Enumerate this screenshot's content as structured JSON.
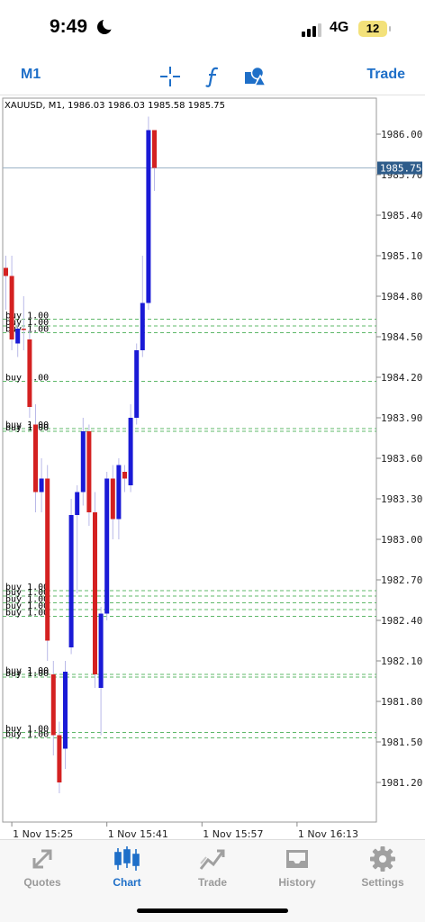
{
  "status": {
    "time": "9:49",
    "network": "4G",
    "battery": "12"
  },
  "toolbar": {
    "period": "M1",
    "icons": [
      "crosshair-icon",
      "function-icon",
      "objects-icon"
    ],
    "trade_label": "Trade",
    "accent": "#1e6fc8"
  },
  "chart_data": {
    "type": "candlestick",
    "title": "XAUUSD, M1, 1986.03 1986.03 1985.58 1985.75",
    "symbol": "XAUUSD",
    "timeframe": "M1",
    "ohlc_header": {
      "open": 1986.03,
      "high": 1986.03,
      "low": 1985.58,
      "close": 1985.75
    },
    "current_price": 1985.75,
    "current_price_label": "1985.75",
    "ylim": [
      1981.05,
      1986.15
    ],
    "y_ticks": [
      {
        "v": 1986.0,
        "label": "1986.00"
      },
      {
        "v": 1985.7,
        "label": "1985.70"
      },
      {
        "v": 1985.4,
        "label": "1985.40"
      },
      {
        "v": 1985.1,
        "label": "1985.10"
      },
      {
        "v": 1984.8,
        "label": "1984.80"
      },
      {
        "v": 1984.5,
        "label": "1984.50"
      },
      {
        "v": 1984.2,
        "label": "1984.20"
      },
      {
        "v": 1983.9,
        "label": "1983.90"
      },
      {
        "v": 1983.6,
        "label": "1983.60"
      },
      {
        "v": 1983.3,
        "label": "1983.30"
      },
      {
        "v": 1983.0,
        "label": "1983.00"
      },
      {
        "v": 1982.7,
        "label": "1982.70"
      },
      {
        "v": 1982.4,
        "label": "1982.40"
      },
      {
        "v": 1982.1,
        "label": "1982.10"
      },
      {
        "v": 1981.8,
        "label": "1981.80"
      },
      {
        "v": 1981.5,
        "label": "1981.50"
      },
      {
        "v": 1981.2,
        "label": "1981.20"
      }
    ],
    "x_ticks": [
      {
        "i": 1,
        "label": "1 Nov 15:25"
      },
      {
        "i": 17,
        "label": "1 Nov 15:41"
      },
      {
        "i": 33,
        "label": "1 Nov 15:57"
      },
      {
        "i": 49,
        "label": "1 Nov 16:13"
      }
    ],
    "up_color": "#1a1ad6",
    "down_color": "#d42121",
    "wick_color": "#b9b9e8",
    "level_color": "#5fb86a",
    "candles": [
      {
        "o": 1985.01,
        "h": 1985.1,
        "l": 1984.7,
        "c": 1984.95
      },
      {
        "o": 1984.95,
        "h": 1985.1,
        "l": 1984.4,
        "c": 1984.48
      },
      {
        "o": 1984.45,
        "h": 1984.6,
        "l": 1984.35,
        "c": 1984.56
      },
      {
        "o": 1984.56,
        "h": 1984.8,
        "l": 1984.4,
        "c": 1984.55
      },
      {
        "o": 1984.48,
        "h": 1984.55,
        "l": 1983.9,
        "c": 1983.98
      },
      {
        "o": 1983.85,
        "h": 1984.0,
        "l": 1983.2,
        "c": 1983.35
      },
      {
        "o": 1983.35,
        "h": 1983.6,
        "l": 1983.2,
        "c": 1983.45
      },
      {
        "o": 1983.45,
        "h": 1983.55,
        "l": 1982.1,
        "c": 1982.25
      },
      {
        "o": 1982.0,
        "h": 1982.1,
        "l": 1981.4,
        "c": 1981.55
      },
      {
        "o": 1981.55,
        "h": 1981.65,
        "l": 1981.12,
        "c": 1981.2
      },
      {
        "o": 1981.45,
        "h": 1982.1,
        "l": 1981.3,
        "c": 1982.02
      },
      {
        "o": 1982.2,
        "h": 1983.3,
        "l": 1982.15,
        "c": 1983.18
      },
      {
        "o": 1983.18,
        "h": 1983.4,
        "l": 1982.6,
        "c": 1983.35
      },
      {
        "o": 1983.35,
        "h": 1983.9,
        "l": 1983.25,
        "c": 1983.8
      },
      {
        "o": 1983.8,
        "h": 1983.85,
        "l": 1983.1,
        "c": 1983.2
      },
      {
        "o": 1983.2,
        "h": 1983.35,
        "l": 1981.9,
        "c": 1982.0
      },
      {
        "o": 1981.9,
        "h": 1982.5,
        "l": 1981.55,
        "c": 1982.45
      },
      {
        "o": 1982.45,
        "h": 1983.5,
        "l": 1982.4,
        "c": 1983.45
      },
      {
        "o": 1983.45,
        "h": 1983.55,
        "l": 1983.0,
        "c": 1983.15
      },
      {
        "o": 1983.15,
        "h": 1983.6,
        "l": 1983.0,
        "c": 1983.55
      },
      {
        "o": 1983.5,
        "h": 1983.55,
        "l": 1983.35,
        "c": 1983.45
      },
      {
        "o": 1983.4,
        "h": 1984.0,
        "l": 1983.35,
        "c": 1983.9
      },
      {
        "o": 1983.9,
        "h": 1984.45,
        "l": 1983.85,
        "c": 1984.4
      },
      {
        "o": 1984.4,
        "h": 1985.1,
        "l": 1984.35,
        "c": 1984.75
      },
      {
        "o": 1984.75,
        "h": 1986.13,
        "l": 1984.7,
        "c": 1986.03
      },
      {
        "o": 1986.03,
        "h": 1986.03,
        "l": 1985.58,
        "c": 1985.75
      }
    ],
    "buy_levels": [
      {
        "price": 1984.63,
        "label": "buy 1.00"
      },
      {
        "price": 1984.58,
        "label": "buy 1.00"
      },
      {
        "price": 1984.53,
        "label": "buy 1.00"
      },
      {
        "price": 1984.17,
        "label": "buy 1.00"
      },
      {
        "price": 1983.82,
        "label": "buy 1.00"
      },
      {
        "price": 1983.8,
        "label": "buy 1.00"
      },
      {
        "price": 1982.62,
        "label": "buy 1.00"
      },
      {
        "price": 1982.58,
        "label": "buy 1.00"
      },
      {
        "price": 1982.53,
        "label": "buy 1.00"
      },
      {
        "price": 1982.48,
        "label": "buy 1.00"
      },
      {
        "price": 1982.43,
        "label": "buy 1.00"
      },
      {
        "price": 1982.0,
        "label": "buy 1.00"
      },
      {
        "price": 1981.98,
        "label": "buy 1.00"
      },
      {
        "price": 1981.57,
        "label": "buy 1.00"
      },
      {
        "price": 1981.53,
        "label": "buy 1.00"
      }
    ]
  },
  "tabbar": {
    "tabs": [
      {
        "label": "Quotes",
        "icon": "quotes-arrows-icon",
        "active": false
      },
      {
        "label": "Chart",
        "icon": "chart-candles-icon",
        "active": true
      },
      {
        "label": "Trade",
        "icon": "trade-line-icon",
        "active": false
      },
      {
        "label": "History",
        "icon": "history-tray-icon",
        "active": false
      },
      {
        "label": "Settings",
        "icon": "gear-icon",
        "active": false
      }
    ]
  }
}
